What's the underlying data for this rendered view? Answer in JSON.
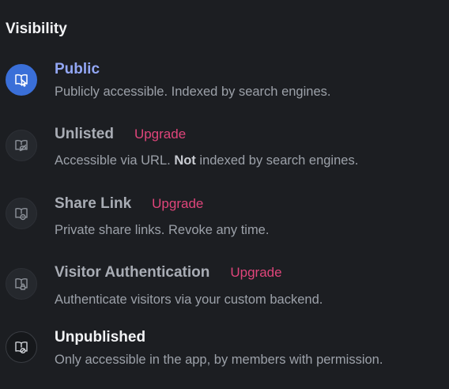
{
  "heading": "Visibility",
  "colors": {
    "background": "#1c1e22",
    "selected_accent": "#3a6fd8",
    "active_title": "#93a7f5",
    "upgrade": "#e0457b"
  },
  "options": [
    {
      "id": "public",
      "title": "Public",
      "description": "Publicly accessible. Indexed by search engines.",
      "icon": "book-cursor-icon",
      "selected": true
    },
    {
      "id": "unlisted",
      "title": "Unlisted",
      "upgrade": "Upgrade",
      "description_before": "Accessible via URL. ",
      "description_bold": "Not",
      "description_after": " indexed by search engines.",
      "icon": "book-eye-off-icon"
    },
    {
      "id": "share-link",
      "title": "Share Link",
      "upgrade": "Upgrade",
      "description": "Private share links. Revoke any time.",
      "icon": "book-link-icon"
    },
    {
      "id": "visitor-auth",
      "title": "Visitor Authentication",
      "upgrade": "Upgrade",
      "description": "Authenticate visitors via your custom backend.",
      "icon": "book-lock-icon"
    },
    {
      "id": "unpublished",
      "title": "Unpublished",
      "description": "Only accessible in the app, by members with permission.",
      "icon": "book-block-icon"
    }
  ]
}
